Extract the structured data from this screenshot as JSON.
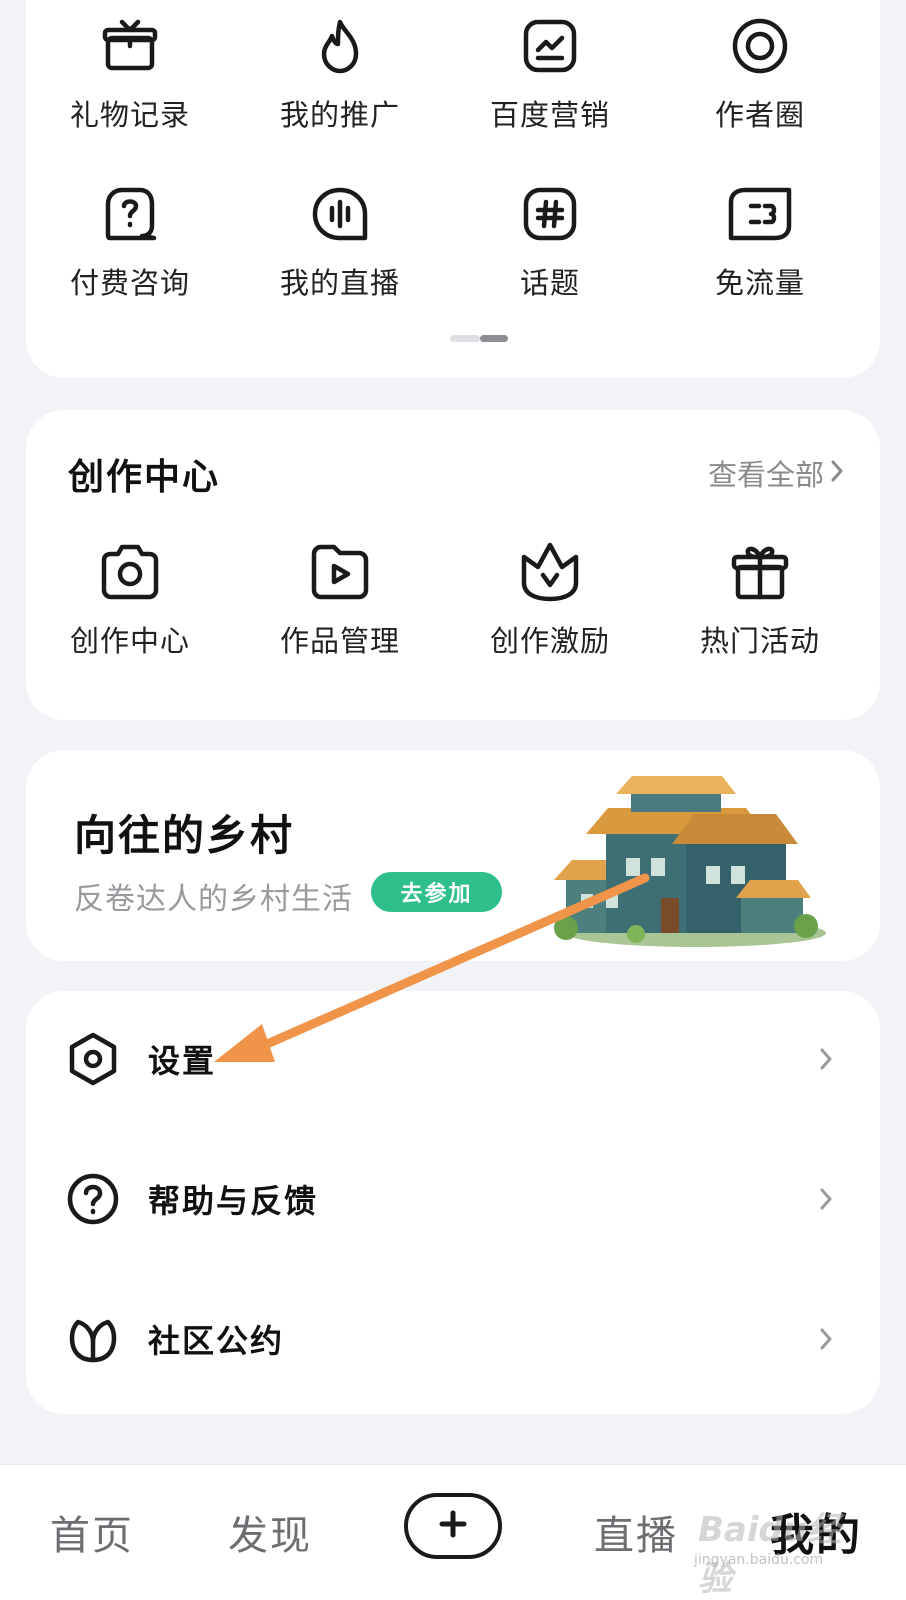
{
  "tools": [
    {
      "label": "礼物记录",
      "icon": "gift-icon"
    },
    {
      "label": "我的推广",
      "icon": "flame-icon"
    },
    {
      "label": "百度营销",
      "icon": "marketing-chart-icon"
    },
    {
      "label": "作者圈",
      "icon": "author-circle-icon"
    },
    {
      "label": "付费咨询",
      "icon": "paid-question-icon"
    },
    {
      "label": "我的直播",
      "icon": "live-audio-icon"
    },
    {
      "label": "话题",
      "icon": "hashtag-icon"
    },
    {
      "label": "免流量",
      "icon": "free-data-icon"
    }
  ],
  "creation": {
    "title": "创作中心",
    "see_all": "查看全部",
    "items": [
      {
        "label": "创作中心",
        "icon": "camera-icon"
      },
      {
        "label": "作品管理",
        "icon": "video-play-icon"
      },
      {
        "label": "创作激励",
        "icon": "crown-icon"
      },
      {
        "label": "热门活动",
        "icon": "gift-box-icon"
      }
    ]
  },
  "banner": {
    "title": "向往的乡村",
    "subtitle": "反卷达人的乡村生活",
    "button": "去参加"
  },
  "menu": [
    {
      "label": "设置",
      "icon": "settings-hexagon-icon"
    },
    {
      "label": "帮助与反馈",
      "icon": "help-question-icon"
    },
    {
      "label": "社区公约",
      "icon": "leaf-icon"
    }
  ],
  "bottom_nav": {
    "home": "首页",
    "discover": "发现",
    "live": "直播",
    "mine": "我的"
  },
  "watermark": {
    "brand": "Baidu经验",
    "url": "jingyan.baidu.com"
  },
  "colors": {
    "accent_green": "#2fbf8a",
    "annotation_arrow": "#f0944a"
  }
}
